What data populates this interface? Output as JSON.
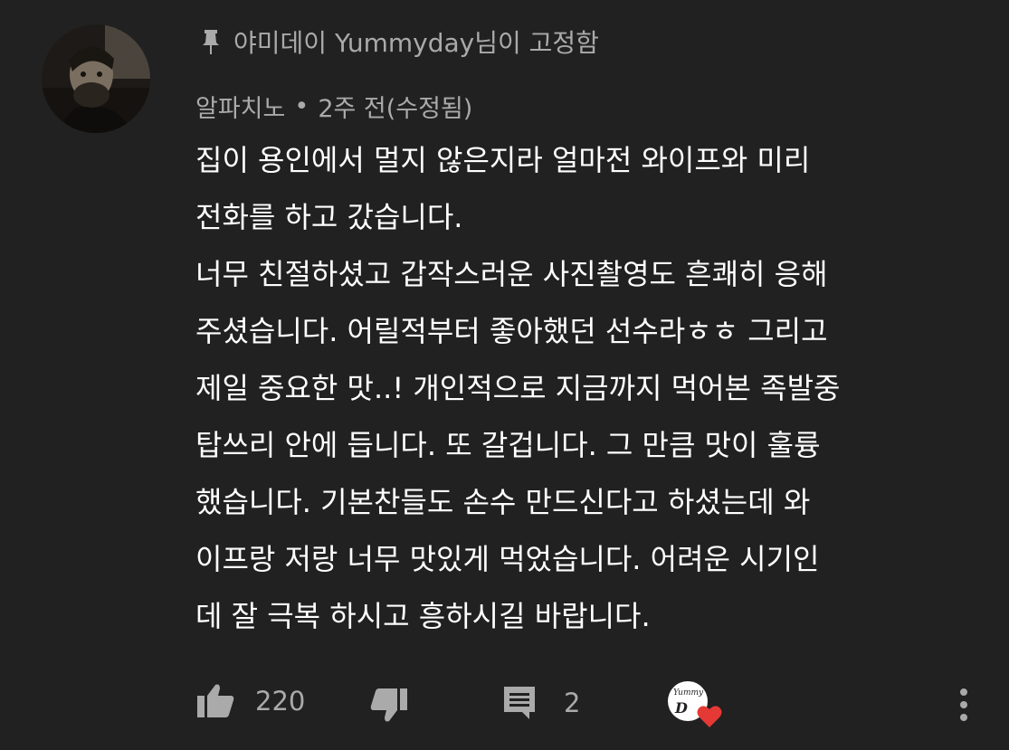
{
  "pinned": {
    "label": "야미데이 Yummyday님이 고정함",
    "icon": "pin-icon"
  },
  "author": {
    "name": "알파치노",
    "separator": "•",
    "time": "2주 전(수정됨)",
    "avatar_icon": "avatar"
  },
  "comment": {
    "lines": [
      "집이 용인에서 멀지 않은지라 얼마전 와이프와 미리",
      "전화를 하고 갔습니다.",
      "너무 친절하셨고 갑작스러운 사진촬영도 흔쾌히 응해",
      "주셨습니다. 어릴적부터 좋아했던 선수라ㅎㅎ 그리고",
      "제일 중요한 맛..! 개인적으로 지금까지 먹어본 족발중",
      "탑쓰리 안에 듭니다. 또 갈겁니다. 그 만큼 맛이 훌륭",
      "했습니다. 기본찬들도 손수 만드신다고 하셨는데 와",
      "이프랑 저랑 너무 맛있게 먹었습니다. 어려운 시기인",
      "데 잘 극복 하시고 흥하시길 바랍니다."
    ]
  },
  "actions": {
    "like_count": "220",
    "reply_count": "2",
    "creator_heart": {
      "logo_small": "Yummy",
      "logo_big": "D",
      "heart_color": "#e53935"
    }
  },
  "colors": {
    "background": "#212121",
    "secondary_text": "#aaaaaa",
    "primary_text": "#ffffff"
  }
}
